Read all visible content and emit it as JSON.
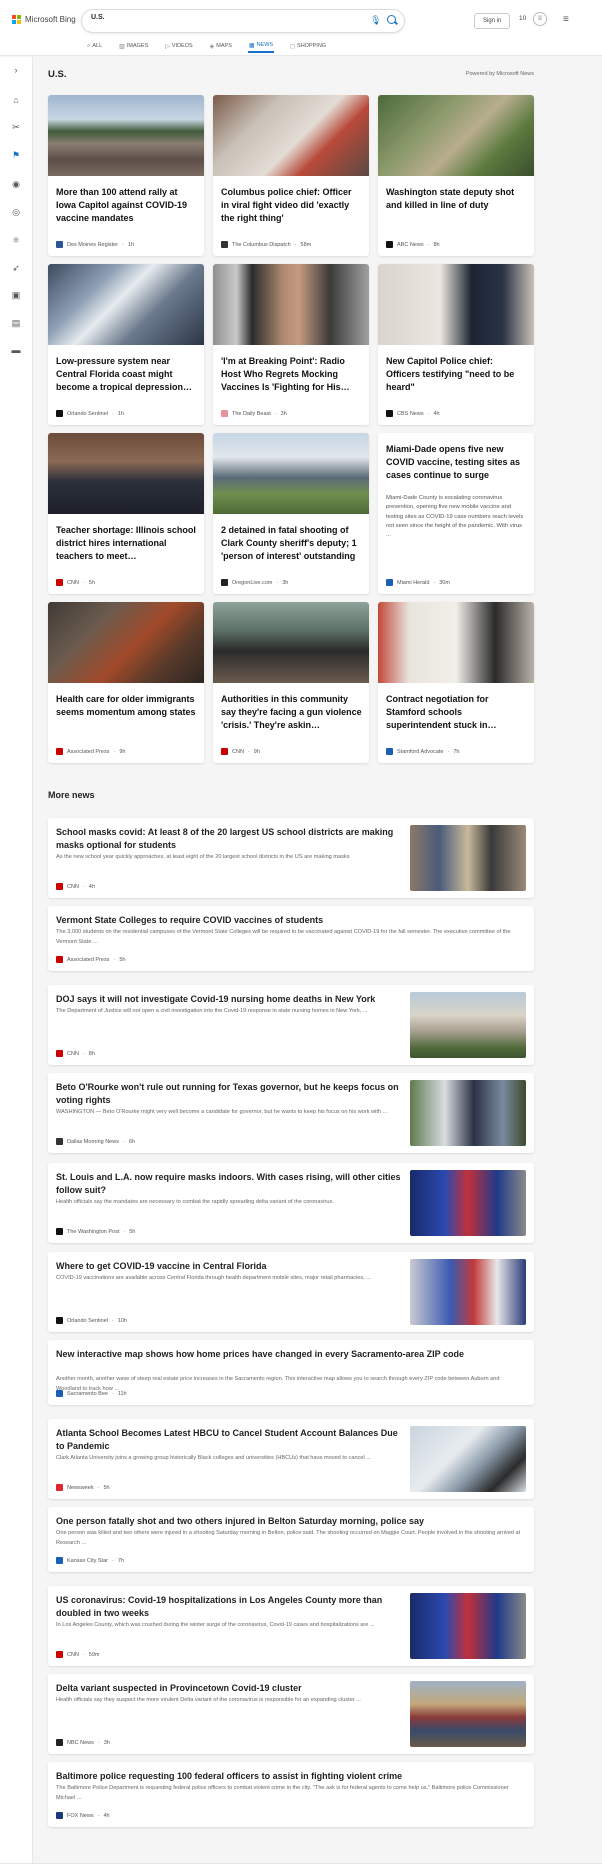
{
  "brand": {
    "name": "Microsoft Bing"
  },
  "search": {
    "value": "U.S."
  },
  "user": {
    "signin_label": "Sign in",
    "rewards": "10"
  },
  "tabs": [
    {
      "label": "ALL",
      "icon": "search-icon"
    },
    {
      "label": "IMAGES",
      "icon": "image-icon"
    },
    {
      "label": "VIDEOS",
      "icon": "video-icon"
    },
    {
      "label": "MAPS",
      "icon": "map-pin-icon"
    },
    {
      "label": "NEWS",
      "icon": "news-icon",
      "active": true
    },
    {
      "label": "SHOPPING",
      "icon": "shopping-bag-icon"
    }
  ],
  "sidebar": [
    {
      "icon": "expand-chevron-icon",
      "glyph": "›"
    },
    {
      "icon": "home-icon",
      "glyph": "⌂"
    },
    {
      "icon": "tools-icon",
      "glyph": "✂"
    },
    {
      "icon": "flag-icon",
      "glyph": "⚑",
      "active": true
    },
    {
      "icon": "location-icon",
      "glyph": "◉"
    },
    {
      "icon": "globe-icon",
      "glyph": "◎"
    },
    {
      "icon": "science-icon",
      "glyph": "⚛"
    },
    {
      "icon": "rocket-icon",
      "glyph": "➶"
    },
    {
      "icon": "entertainment-icon",
      "glyph": "▣"
    },
    {
      "icon": "briefcase-icon",
      "glyph": "▤"
    },
    {
      "icon": "card-icon",
      "glyph": "▬"
    }
  ],
  "section": {
    "title": "U.S.",
    "powered_by": "Powered by Microsoft News"
  },
  "cards": [
    {
      "title": "More than 100 attend rally at Iowa Capitol against COVID-19 vaccine mandates",
      "source": "Des Moines Register",
      "time": "1h",
      "logo_color": "#2b5797",
      "img": "crowd"
    },
    {
      "title": "Columbus police chief: Officer in viral fight video did 'exactly the right thing'",
      "source": "The Columbus Dispatch",
      "time": "58m",
      "logo_color": "#333333",
      "img": "store"
    },
    {
      "title": "Washington state deputy shot and killed in line of duty",
      "source": "ABC News",
      "time": "8h",
      "logo_color": "#111111",
      "img": "aerial"
    },
    {
      "title": "Low-pressure system near Central Florida coast might become a tropical depression…",
      "source": "Orlando Sentinel",
      "time": "1h",
      "logo_color": "#111111",
      "img": "satellite"
    },
    {
      "title": "'I'm at Breaking Point': Radio Host Who Regrets Mocking Vaccines Is 'Fighting for His…",
      "source": "The Daily Beast",
      "time": "3h",
      "logo_color": "#e8929e",
      "img": "portrait"
    },
    {
      "title": "New Capitol Police chief: Officers testifying \"need to be heard\"",
      "source": "CBS News",
      "time": "4h",
      "logo_color": "#111111",
      "img": "police"
    },
    {
      "title": "Teacher shortage: Illinois school district hires international teachers to meet…",
      "source": "CNN",
      "time": "5h",
      "logo_color": "#cc0000",
      "img": "man"
    },
    {
      "title": "2 detained in fatal shooting of Clark County sheriff's deputy; 1 'person of interest' outstanding",
      "source": "OregonLive.com",
      "time": "3h",
      "logo_color": "#222222",
      "img": "houses"
    },
    {
      "title": "Miami-Dade opens five new COVID vaccine, testing sites as cases continue to surge",
      "source": "Miami Herald",
      "time": "30m",
      "logo_color": "#1a5fb4",
      "text_only": true,
      "desc": "Miami-Dade County is escalating coronavirus prevention, opening five new mobile vaccine and testing sites as COVID-19 case numbers reach levels not seen since the height of the pandemic. With virus ..."
    },
    {
      "title": "Health care for older immigrants seems momentum among states",
      "source": "Associated Press",
      "time": "9h",
      "logo_color": "#cc0000",
      "img": "stairs"
    },
    {
      "title": "Authorities in this community say they're facing a gun violence 'crisis.' They're askin…",
      "source": "CNN",
      "time": "9h",
      "logo_color": "#cc0000",
      "img": "woman"
    },
    {
      "title": "Contract negotiation for Stamford schools superintendent stuck in…",
      "source": "Stamford Advocate",
      "time": "7h",
      "logo_color": "#1a5fb4",
      "img": "office"
    }
  ],
  "more_news": {
    "title": "More news",
    "items": [
      {
        "title": "School masks covid: At least 8 of the 20 largest US school districts are making masks optional for students",
        "desc": "As the new school year quickly approaches, at least eight of the 20 largest school districts in the US are making masks",
        "source": "CNN",
        "time": "4h",
        "logo_color": "#cc0000",
        "img": "students"
      },
      {
        "title": "Vermont State Colleges to require COVID vaccines of students",
        "desc": "The 3,000 students on the residential campuses of the Vermont State Colleges will be required to be vaccinated against COVID-19 for the fall semester. The executive committee of the Vermont State ...",
        "source": "Associated Press",
        "time": "5h",
        "logo_color": "#cc0000"
      },
      {
        "title": "DOJ says it will not investigate Covid-19 nursing home deaths in New York",
        "desc": "The Department of Justice will not open a civil investigation into the Covid-19 response in state nursing homes in New York, ...",
        "source": "CNN",
        "time": "8h",
        "logo_color": "#cc0000",
        "img": "building"
      },
      {
        "title": "Beto O'Rourke won't rule out running for Texas governor, but he keeps focus on voting rights",
        "desc": "WASHINGTON — Beto O'Rourke might very well become a candidate for governor, but he wants to keep his focus on his work with ...",
        "source": "Dallas Morning News",
        "time": "6h",
        "logo_color": "#333333",
        "img": "rally"
      },
      {
        "title": "St. Louis and L.A. now require masks indoors. With cases rising, will other cities follow suit?",
        "desc": "Health officials say the mandates are necessary to combat the rapidly spreading delta variant of the coronavirus.",
        "source": "The Washington Post",
        "time": "5h",
        "logo_color": "#111111",
        "img": "station"
      },
      {
        "title": "Where to get COVID-19 vaccine in Central Florida",
        "desc": "COVID-19 vaccinations are available across Central Florida through health department mobile sites, major retail pharmacies, ...",
        "source": "Orlando Sentinel",
        "time": "10h",
        "logo_color": "#111111",
        "img": "vaccine"
      },
      {
        "title": "New interactive map shows how home prices have changed in every Sacramento-area ZIP code",
        "desc": "Another month, another wave of steep real estate price increases in the Sacramento region. This interactive map allows you to search through every ZIP code between Auburn and Woodland to track how ...",
        "source": "Sacramento Bee",
        "time": "11h",
        "logo_color": "#1a5fb4"
      },
      {
        "title": "Atlanta School Becomes Latest HBCU to Cancel Student Account Balances Due to Pandemic",
        "desc": "Clark Atlanta University joins a growing group historically Black colleges and universities (HBCUs) that have moved to cancel ...",
        "source": "Newsweek",
        "time": "5h",
        "logo_color": "#e0262f",
        "img": "form"
      },
      {
        "title": "One person fatally shot and two others injured in Belton Saturday morning, police say",
        "desc": "One person was killed and two others were injured in a shooting Saturday morning in Belton, police said. The shooting occurred on Maggie Court. People involved in the shooting arrived at Research ...",
        "source": "Kansas City Star",
        "time": "7h",
        "logo_color": "#1a5fb4"
      },
      {
        "title": "US coronavirus: Covid-19 hospitalizations in Los Angeles County more than doubled in two weeks",
        "desc": "In Los Angeles County, which was crushed during the winter surge of the coronavirus, Covid-19 cases and hospitalizations are ...",
        "source": "CNN",
        "time": "59m",
        "logo_color": "#cc0000",
        "img": "station"
      },
      {
        "title": "Delta variant suspected in Provincetown Covid-19 cluster",
        "desc": "Health officials say they suspect the more virulent Delta variant of the coronavirus is responsible for an expanding cluster ...",
        "source": "NBC News",
        "time": "3h",
        "logo_color": "#222222",
        "img": "street"
      },
      {
        "title": "Baltimore police requesting 100 federal officers to assist in fighting violent crime",
        "desc": "The Baltimore Police Department is requesting federal police officers to combat violent crime in the city. \"The ask is for federal agents to come help us,\" Baltimore police Commissioner Michael ...",
        "source": "FOX News",
        "time": "4h",
        "logo_color": "#1a3a7a"
      }
    ]
  }
}
